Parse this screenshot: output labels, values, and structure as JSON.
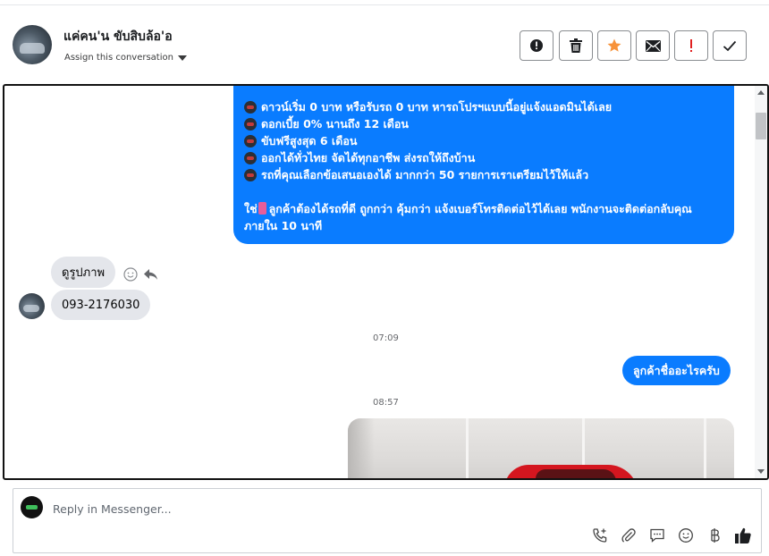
{
  "header": {
    "contact_name": "แค่คน'น ขับสิบล้อ'อ",
    "assign_label": "Assign this conversation",
    "actions": [
      {
        "name": "spam-button",
        "icon": "alert-circle-icon"
      },
      {
        "name": "delete-button",
        "icon": "trash-icon"
      },
      {
        "name": "star-button",
        "icon": "star-icon",
        "color": "#f7923a"
      },
      {
        "name": "email-button",
        "icon": "envelope-icon"
      },
      {
        "name": "important-button",
        "icon": "exclamation-icon",
        "color": "#e02020"
      },
      {
        "name": "done-button",
        "icon": "check-icon"
      }
    ]
  },
  "conversation": {
    "promo_lines": [
      "ดาวน์เริ่ม 0 บาท หรือรับรถ 0 บาท หารถโปรฯแบบนี้อยู่แจ้งแอดมินได้เลย",
      "ดอกเบี้ย 0% นานถึง 12 เดือน",
      "ขับฟรีสูงสุด 6 เดือน",
      "ออกได้ทั่วไทย จัดได้ทุกอาชีพ ส่งรถให้ถึงบ้าน",
      "รถที่คุณเลือกข้อเสนอเองได้ มากกว่า 50 รายการเราเตรียมไว้ให้แล้ว"
    ],
    "promo_closing_prefix": "ใช่",
    "promo_closing": "ลูกค้าต้องได้รถที่ดี ถูกกว่า คุ้มกว่า แจ้งเบอร์โทรติดต่อไว้ได้เลย พนักงานจะติดต่อกลับคุณภายใน 10 นาที",
    "incoming_1": "ดูรูปภาพ",
    "incoming_2": "093-2176030",
    "time_1": "07:09",
    "outgoing_1": "ลูกค้าชื่ออะไรครับ",
    "time_2": "08:57"
  },
  "composer": {
    "placeholder": "Reply in Messenger...",
    "tools": [
      "call-plus-icon",
      "paperclip-icon",
      "saved-reply-icon",
      "emoji-icon",
      "baht-icon",
      "thumbs-up-icon"
    ]
  }
}
